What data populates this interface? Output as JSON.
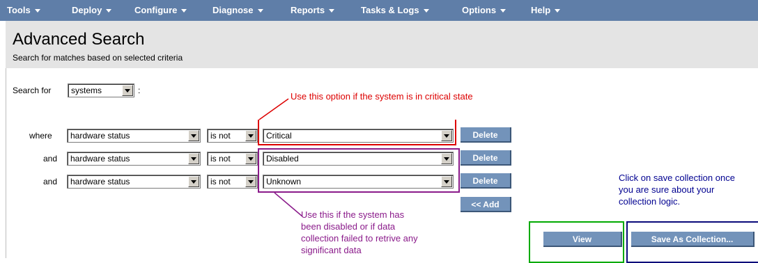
{
  "menu": {
    "items": [
      {
        "label": "Tools"
      },
      {
        "label": "Deploy"
      },
      {
        "label": "Configure"
      },
      {
        "label": "Diagnose"
      },
      {
        "label": "Reports"
      },
      {
        "label": "Tasks & Logs"
      },
      {
        "label": "Options"
      },
      {
        "label": "Help"
      }
    ]
  },
  "header": {
    "title": "Advanced Search",
    "subtitle": "Search for matches based on selected criteria"
  },
  "search": {
    "label": "Search for",
    "type_value": "systems",
    "colon": ":"
  },
  "criteria": [
    {
      "connector": "where",
      "field": "hardware status",
      "operator": "is not",
      "value": "Critical",
      "delete_label": "Delete"
    },
    {
      "connector": "and",
      "field": "hardware status",
      "operator": "is not",
      "value": "Disabled",
      "delete_label": "Delete"
    },
    {
      "connector": "and",
      "field": "hardware status",
      "operator": "is not",
      "value": "Unknown",
      "delete_label": "Delete"
    }
  ],
  "actions": {
    "add_label": "<< Add",
    "view_label": "View",
    "save_label": "Save As Collection..."
  },
  "annotations": {
    "critical": "Use this option if the system is in critical state",
    "disabled": [
      "Use this if the system has",
      "been disabled or if data",
      "collection failed to retrive any",
      "significant data"
    ],
    "save": [
      "Click on save collection once",
      "you are sure about your",
      "collection logic."
    ]
  },
  "colors": {
    "menubar": "#5f7ea8",
    "button": "#7393ba",
    "annot_red": "#dd0000",
    "annot_purple": "#8a1a8a",
    "annot_blue": "#000090",
    "annot_green": "#00aa00",
    "annot_navy": "#0a0a7a"
  }
}
